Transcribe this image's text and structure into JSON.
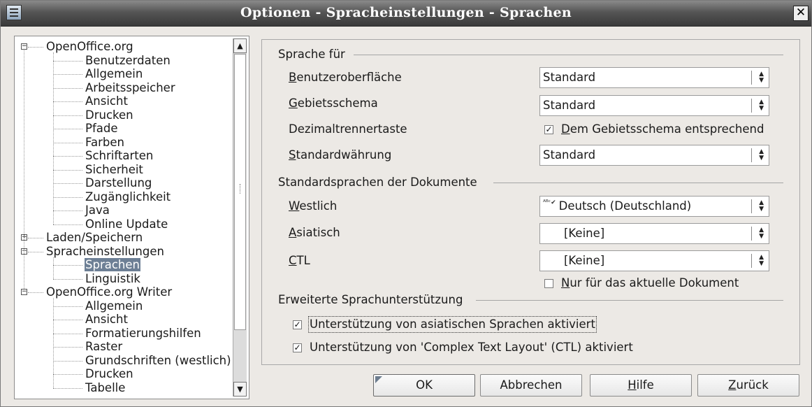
{
  "window": {
    "title": "Optionen - Spracheinstellungen - Sprachen",
    "close_label": "✕"
  },
  "tree": {
    "rows": [
      {
        "label": "OpenOffice.org",
        "expander": "⊟"
      },
      {
        "label": "Benutzerdaten"
      },
      {
        "label": "Allgemein"
      },
      {
        "label": "Arbeitsspeicher"
      },
      {
        "label": "Ansicht"
      },
      {
        "label": "Drucken"
      },
      {
        "label": "Pfade"
      },
      {
        "label": "Farben"
      },
      {
        "label": "Schriftarten"
      },
      {
        "label": "Sicherheit"
      },
      {
        "label": "Darstellung"
      },
      {
        "label": "Zugänglichkeit"
      },
      {
        "label": "Java"
      },
      {
        "label": "Online Update"
      },
      {
        "label": "Laden/Speichern",
        "expander": "⊞"
      },
      {
        "label": "Spracheinstellungen",
        "expander": "⊟"
      },
      {
        "label": "Sprachen",
        "selected": true
      },
      {
        "label": "Linguistik"
      },
      {
        "label": "OpenOffice.org Writer",
        "expander": "⊟"
      },
      {
        "label": "Allgemein"
      },
      {
        "label": "Ansicht"
      },
      {
        "label": "Formatierungshilfen"
      },
      {
        "label": "Raster"
      },
      {
        "label": "Grundschriften (westlich)"
      },
      {
        "label": "Drucken"
      },
      {
        "label": "Tabelle"
      }
    ]
  },
  "sections": {
    "sprache_fuer": "Sprache für",
    "standardsprachen": "Standardsprachen der Dokumente",
    "erweitert": "Erweiterte Sprachunterstützung"
  },
  "fields": {
    "benutzeroberflaeche": {
      "label": "Benutzeroberfläche",
      "value": "Standard"
    },
    "gebietsschema": {
      "label": "Gebietsschema",
      "value": "Standard"
    },
    "dezimaltrennertaste": {
      "label": "Dezimaltrennertaste",
      "checkbox_label": "Dem Gebietsschema entsprechend",
      "checked": true
    },
    "standardwaehrung": {
      "label": "Standardwährung",
      "value": "Standard"
    },
    "westlich": {
      "label": "Westlich",
      "value": "Deutsch (Deutschland)",
      "icon": "spellcheck-icon"
    },
    "asiatisch": {
      "label": "Asiatisch",
      "value": "[Keine]"
    },
    "ctl": {
      "label": "CTL",
      "value": "[Keine]"
    },
    "nur_aktuelles": {
      "label": "Nur für das aktuelle Dokument",
      "checked": false
    },
    "asiatische_unterstuetzung": {
      "label": "Unterstützung von asiatischen Sprachen aktiviert",
      "checked": true
    },
    "ctl_unterstuetzung": {
      "label": "Unterstützung von 'Complex Text Layout' (CTL) aktiviert",
      "checked": true
    }
  },
  "buttons": {
    "ok": "OK",
    "abbrechen": "Abbrechen",
    "hilfe": "Hilfe",
    "zurueck": "Zurück"
  },
  "colors": {
    "selection": "#6d7f95",
    "dialog_bg": "#ece9e5",
    "titlebar": "#4a4a4a"
  }
}
